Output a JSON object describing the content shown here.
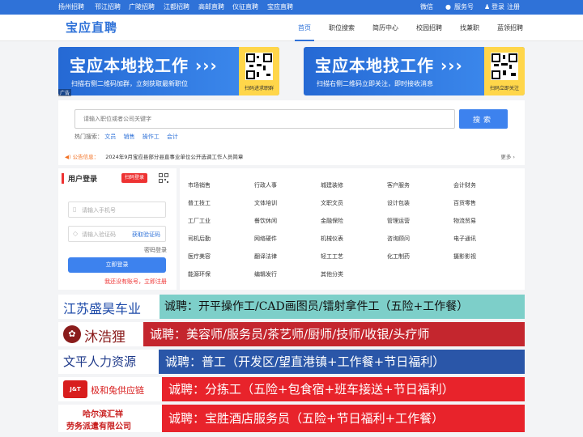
{
  "topbar": {
    "cities": [
      "扬州招聘",
      "邗江招聘",
      "广陵招聘",
      "江都招聘",
      "高邮直聘",
      "仪征直聘",
      "宝应直聘"
    ],
    "wechat": "微信",
    "service": "服务号",
    "login": "登录",
    "register": "注册"
  },
  "header": {
    "logo": "宝应直聘",
    "nav": [
      "首页",
      "职位搜索",
      "简历中心",
      "校园招聘",
      "找兼职",
      "蓝领招聘"
    ]
  },
  "banners": [
    {
      "title": "宝应本地找工作 ›››",
      "subtitle": "扫描右侧二维码加群，立刻获取最新职位",
      "qr_label": "扫码进求职群"
    },
    {
      "title": "宝应本地找工作 ›››",
      "subtitle": "扫描右侧二维码立即关注，即时接收消息",
      "qr_label": "扫码立即关注"
    }
  ],
  "ad_tag": "广告",
  "search": {
    "placeholder": "请输入职位或者公司关键字",
    "button": "搜索",
    "hot_label": "热门搜索：",
    "hot_keywords": [
      "文员",
      "销售",
      "操作工",
      "会计"
    ]
  },
  "notice": {
    "label": "公告信息：",
    "text": "2024年9月宝应县部分县直事业单位公开选调工作人员简章",
    "more": "更多 ›"
  },
  "login": {
    "title": "用户登录",
    "scan": "扫码登录",
    "phone_placeholder": "请输入手机号",
    "code_placeholder": "请输入验证码",
    "get_code": "获取验证码",
    "pwd_login": "密码登录",
    "button": "立即登录",
    "register": "我还没有账号，立即注册"
  },
  "categories": [
    [
      "市场销售",
      "行政人事",
      "城建装修",
      "客户服务",
      "会计财务"
    ],
    [
      "普工技工",
      "文体培训",
      "文职文员",
      "设计包装",
      "百货零售"
    ],
    [
      "工厂工业",
      "餐饮休闲",
      "金融保险",
      "管理运营",
      "物流贸易"
    ],
    [
      "司机后勤",
      "网络硬件",
      "机械仪表",
      "咨询顾问",
      "电子通讯"
    ],
    [
      "医疗美容",
      "翻译法律",
      "轻工工艺",
      "化工制药",
      "摄影影视"
    ],
    [
      "能源环保",
      "编辑发行",
      "其他分类"
    ]
  ],
  "ads": [
    {
      "company": "江苏盛昊车业",
      "text": "诚聘：开平操作工/CAD画图员/镭射拿件工（五险+工作餐）",
      "company_color": "#1d4aa8",
      "bar_color": "#7dcfc9",
      "text_color": "#111111"
    },
    {
      "company": "沐浩狸",
      "text": "诚聘：美容师/服务员/茶艺师/厨师/技师/收银/头疗师",
      "company_color": "#8a1c1c",
      "bar_color": "#c4262e",
      "text_color": "#ffffff"
    },
    {
      "company": "文平人力资源",
      "text": "诚聘：普工（开发区/望直港镇+工作餐+节日福利）",
      "company_color": "#1f3a8a",
      "bar_color": "#2a56a8",
      "text_color": "#ffffff"
    },
    {
      "company": "极和兔供应链",
      "text": "诚聘：分拣工（五险+包食宿+班车接送+节日福利）",
      "company_color": "#d81e1e",
      "bar_color": "#e8232b",
      "text_color": "#ffffff"
    },
    {
      "company_lines": [
        "哈尔滨汇祥",
        "劳务派遣有限公司"
      ],
      "text": "诚聘：宝胜酒店服务员（五险+节日福利+工作餐）",
      "company_color": "#c81d1d",
      "bar_color": "#e8232b",
      "text_color": "#ffffff"
    }
  ],
  "colors": {
    "primary": "#2f72d8",
    "accent": "#e33333",
    "notice": "#f37021"
  }
}
